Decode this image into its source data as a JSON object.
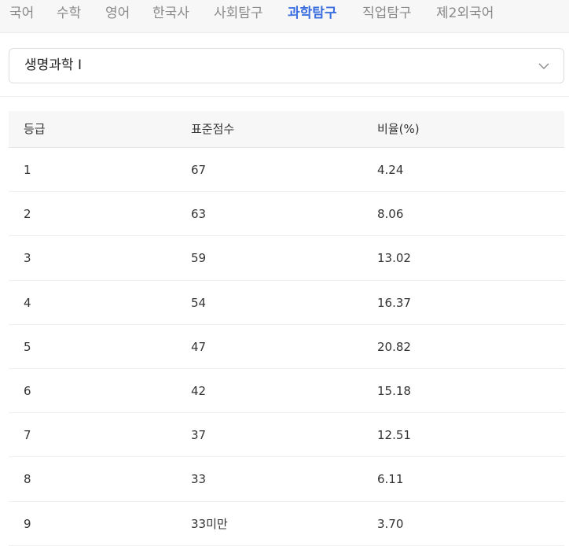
{
  "tabs": [
    {
      "label": "국어",
      "active": false
    },
    {
      "label": "수학",
      "active": false
    },
    {
      "label": "영어",
      "active": false
    },
    {
      "label": "한국사",
      "active": false
    },
    {
      "label": "사회탐구",
      "active": false
    },
    {
      "label": "과학탐구",
      "active": true
    },
    {
      "label": "직업탐구",
      "active": false
    },
    {
      "label": "제2외국어",
      "active": false
    }
  ],
  "subject_select": {
    "value": "생명과학 I",
    "icon": "chevron-down-icon"
  },
  "table": {
    "headers": [
      "등급",
      "표준점수",
      "비율(%)"
    ],
    "rows": [
      [
        "1",
        "67",
        "4.24"
      ],
      [
        "2",
        "63",
        "8.06"
      ],
      [
        "3",
        "59",
        "13.02"
      ],
      [
        "4",
        "54",
        "16.37"
      ],
      [
        "5",
        "47",
        "20.82"
      ],
      [
        "6",
        "42",
        "15.18"
      ],
      [
        "7",
        "37",
        "12.51"
      ],
      [
        "8",
        "33",
        "6.11"
      ],
      [
        "9",
        "33미만",
        "3.70"
      ]
    ]
  },
  "colors": {
    "active_tab": "#3b6fe0",
    "inactive_tab": "#8a8a8a",
    "tabbar_bg": "#f7f7f7"
  }
}
